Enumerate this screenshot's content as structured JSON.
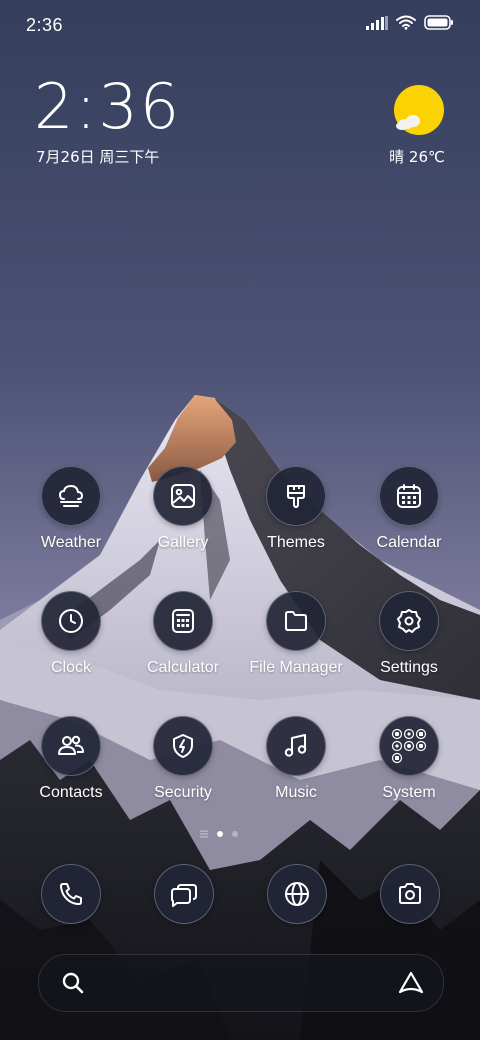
{
  "status_bar": {
    "time": "2:36"
  },
  "lockclock": {
    "time": "2:36",
    "date": "7月26日 周三下午"
  },
  "weather": {
    "condition_temp": "晴 26℃"
  },
  "apps": [
    {
      "label": "Weather",
      "icon": "weather-icon"
    },
    {
      "label": "Gallery",
      "icon": "gallery-icon"
    },
    {
      "label": "Themes",
      "icon": "themes-icon"
    },
    {
      "label": "Calendar",
      "icon": "calendar-icon"
    },
    {
      "label": "Clock",
      "icon": "clock-icon"
    },
    {
      "label": "Calculator",
      "icon": "calculator-icon"
    },
    {
      "label": "File Manager",
      "icon": "folder-icon"
    },
    {
      "label": "Settings",
      "icon": "gear-icon"
    },
    {
      "label": "Contacts",
      "icon": "contacts-icon"
    },
    {
      "label": "Security",
      "icon": "shield-icon"
    },
    {
      "label": "Music",
      "icon": "music-note-icon"
    },
    {
      "label": "System",
      "icon": "folder-grid-icon"
    }
  ],
  "dock": [
    {
      "icon": "phone-icon"
    },
    {
      "icon": "messages-icon"
    },
    {
      "icon": "browser-icon"
    },
    {
      "icon": "camera-icon"
    }
  ],
  "pager": {
    "pages": 2,
    "current": 1
  },
  "colors": {
    "sky_top": "#3a4260",
    "sky_bottom": "#8c88ab",
    "icon_bg": "#222536",
    "sun": "#fbd305"
  }
}
